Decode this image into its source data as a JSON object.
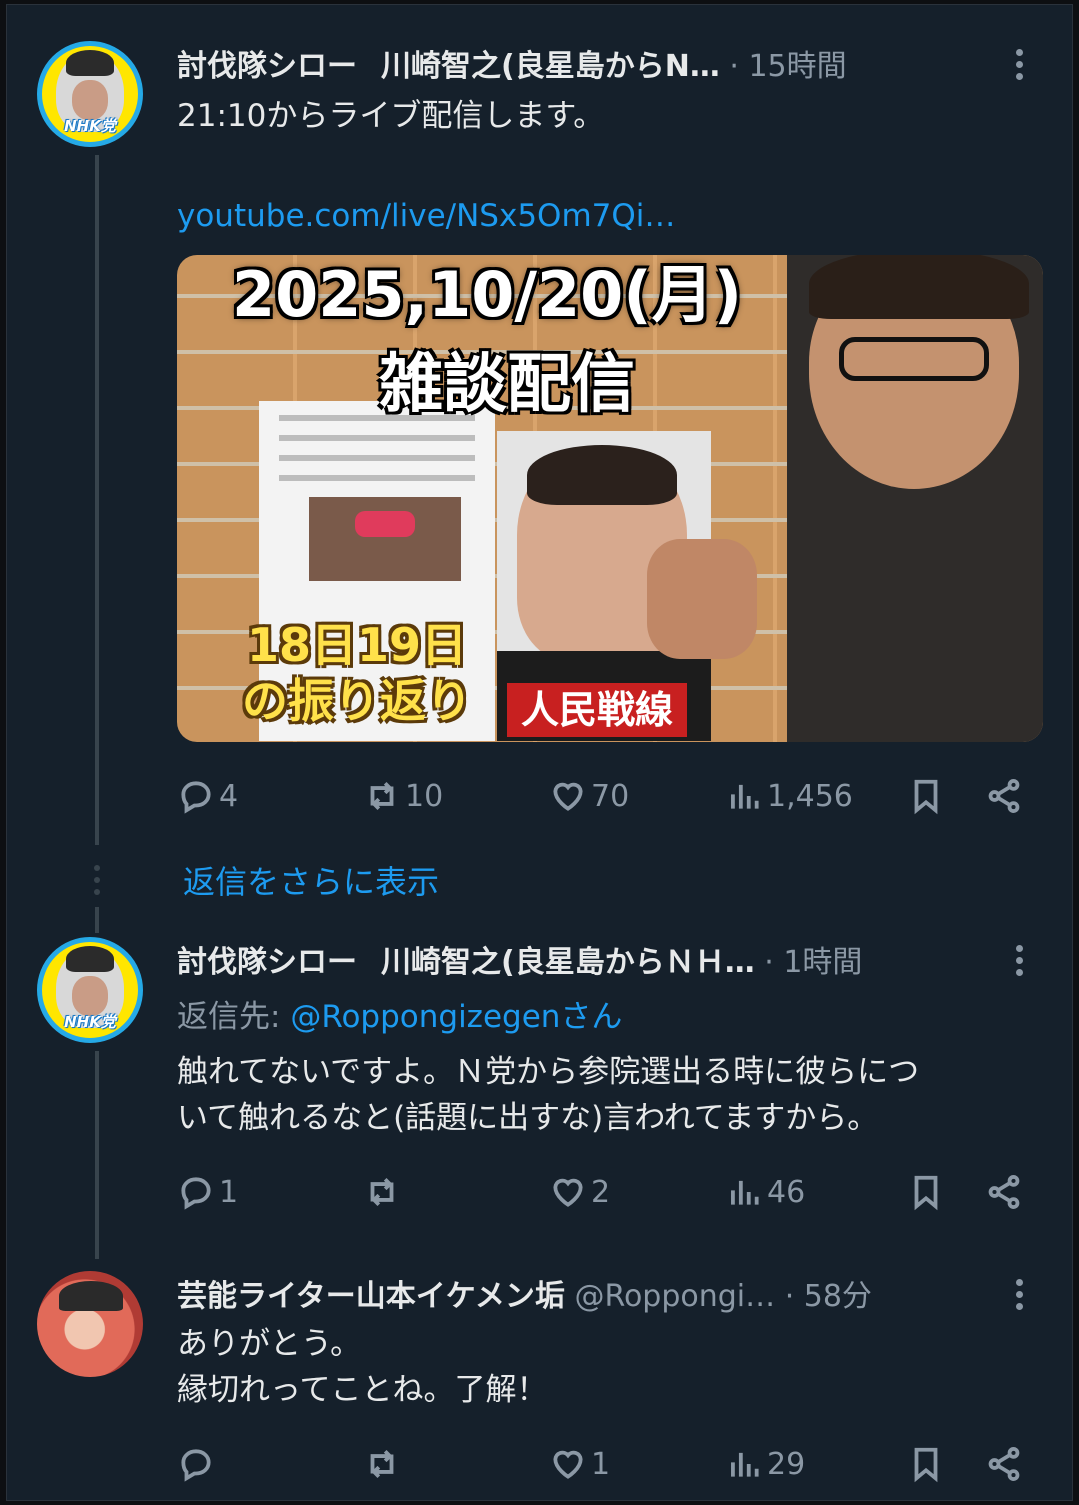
{
  "thread": {
    "show_more_label": "返信をさらに表示"
  },
  "posts": [
    {
      "author": "討伐隊シロー　川崎智之(良星島からN…",
      "author_short": "討伐隊シロー",
      "author_rest": "川崎智之(良星島からN…",
      "time": "· 15時間",
      "avatar_badge": "NHK党",
      "text_line1": "21:10からライブ配信します。",
      "link": "youtube.com/live/NSx5Om7Qi…",
      "media": {
        "title": "2025,10/20(月)",
        "subtitle": "雑談配信",
        "caption_line1": "18日19日",
        "caption_line2": "の振り返り",
        "tag": "人民戦線"
      },
      "stats": {
        "replies": "4",
        "reposts": "10",
        "likes": "70",
        "views": "1,456"
      }
    },
    {
      "author_short": "討伐隊シロー",
      "author_rest": "川崎智之(良星島からＮＨ…",
      "time": "· 1時間",
      "avatar_badge": "NHK党",
      "reply_prefix": "返信先:",
      "reply_handle": "@Roppongizegenさん",
      "text_line1": "触れてないですよ。Ｎ党から参院選出る時に彼らにつ",
      "text_line2": "いて触れるなと(話題に出すな)言われてますから。",
      "stats": {
        "replies": "1",
        "reposts": "",
        "likes": "2",
        "views": "46"
      }
    },
    {
      "author_short": "芸能ライター山本イケメン垢",
      "handle": "@Roppongi…",
      "time": "· 58分",
      "text_line1": "ありがとう。",
      "text_line2": "縁切れってことね。了解！",
      "stats": {
        "replies": "",
        "reposts": "",
        "likes": "1",
        "views": "29"
      }
    }
  ],
  "icons": [
    "reply-icon",
    "repost-icon",
    "like-icon",
    "views-icon",
    "bookmark-icon",
    "share-icon",
    "more-icon"
  ],
  "colors": {
    "background": "#15202b",
    "text": "#e7e9ea",
    "muted": "#8b98a5",
    "link": "#1d9bf0"
  }
}
